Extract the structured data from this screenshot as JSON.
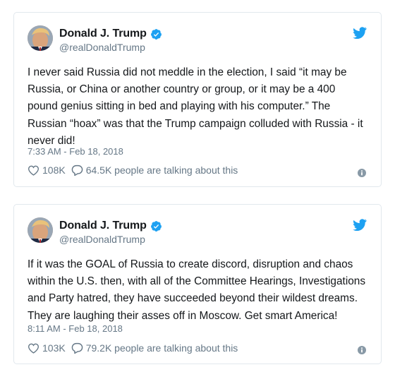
{
  "colors": {
    "twitter_blue": "#1da1f2",
    "text": "#14171a",
    "secondary_text": "#657786",
    "border": "#e1e8ed"
  },
  "icons": [
    "avatar",
    "verified-badge-icon",
    "twitter-bird-icon",
    "heart-icon",
    "reply-bubble-icon",
    "info-icon"
  ],
  "tweets": [
    {
      "display_name": "Donald J. Trump",
      "handle": "@realDonaldTrump",
      "lines": [
        "I never said Russia did not meddle in the election, I said “it may be",
        "Russia, or China or another country or group, or it may be a 400",
        "pound genius sitting in bed and playing with his computer.” The",
        "Russian “hoax” was that the Trump campaign colluded with Russia - it",
        "never did!"
      ],
      "timestamp": "7:33 AM - Feb 18, 2018",
      "likes": "108K",
      "talking": "64.5K people are talking about this"
    },
    {
      "display_name": "Donald J. Trump",
      "handle": "@realDonaldTrump",
      "lines": [
        "If it was the GOAL of Russia to create discord, disruption and chaos",
        "within the U.S. then, with all of the Committee Hearings, Investigations",
        "and Party hatred, they have succeeded beyond their wildest dreams.",
        "They are laughing their asses off in Moscow. Get smart America!"
      ],
      "timestamp": "8:11 AM - Feb 18, 2018",
      "likes": "103K",
      "talking": "79.2K people are talking about this"
    }
  ]
}
